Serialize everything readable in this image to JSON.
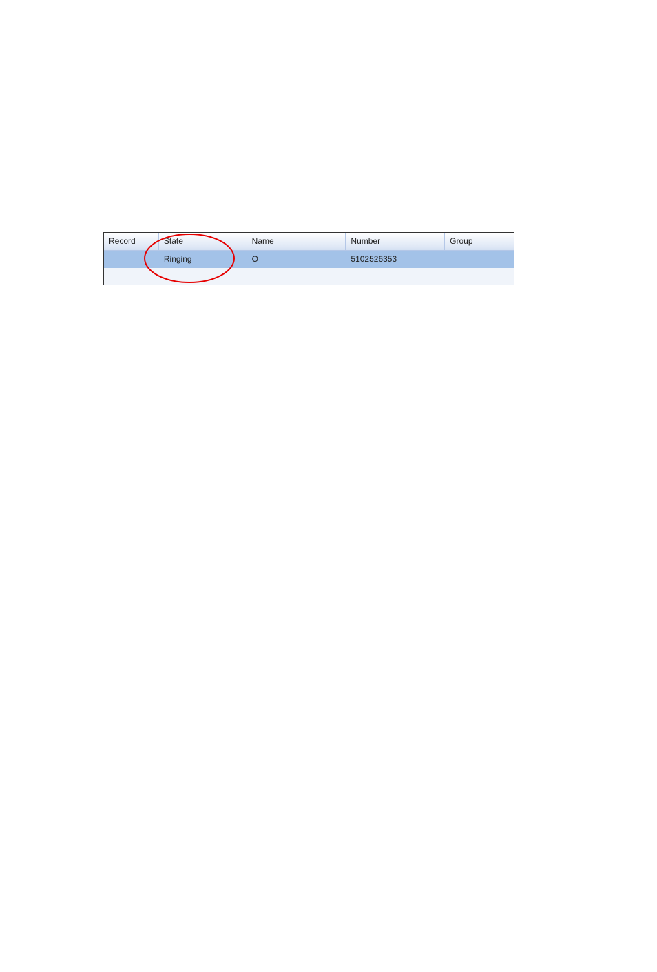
{
  "table": {
    "columns": [
      {
        "key": "record",
        "label": "Record"
      },
      {
        "key": "state",
        "label": "State"
      },
      {
        "key": "name",
        "label": "Name"
      },
      {
        "key": "number",
        "label": "Number"
      },
      {
        "key": "group",
        "label": "Group"
      }
    ],
    "rows": [
      {
        "selected": true,
        "record": "",
        "state": "Ringing",
        "name": "O",
        "number": "5102526353",
        "group": ""
      }
    ]
  },
  "annotation": {
    "highlight_target": "state-cell",
    "color": "#e60000"
  }
}
